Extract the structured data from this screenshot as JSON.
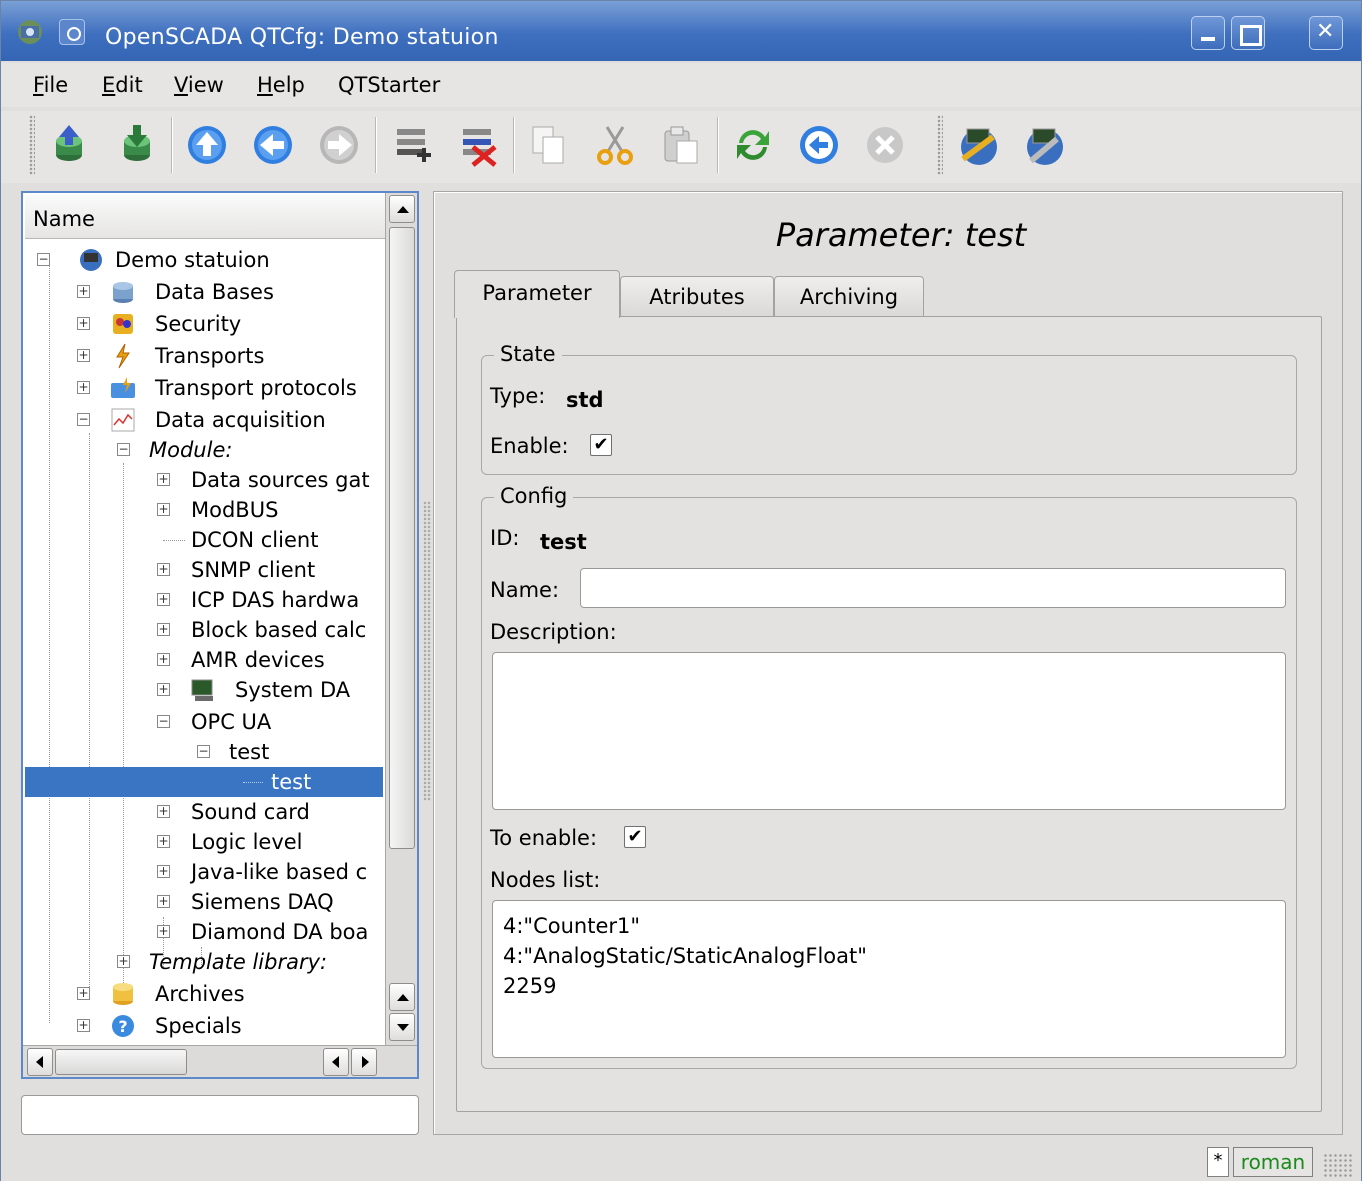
{
  "window": {
    "title": "OpenSCADA QTCfg: Demo statuion"
  },
  "menu": [
    "File",
    "Edit",
    "View",
    "Help",
    "QTStarter"
  ],
  "toolbar": {
    "icons": [
      "load-db-icon",
      "save-db-icon",
      "up-icon",
      "back-icon",
      "forward-icon",
      "add-item-icon",
      "delete-item-icon",
      "copy-icon",
      "cut-icon",
      "paste-icon",
      "refresh-icon",
      "start-icon",
      "stop-icon",
      "remote-station-icon",
      "station-config-icon"
    ]
  },
  "tree": {
    "header": "Name",
    "nodes": [
      {
        "label": "Demo statuion"
      },
      {
        "label": "Data Bases"
      },
      {
        "label": "Security"
      },
      {
        "label": "Transports"
      },
      {
        "label": "Transport protocols"
      },
      {
        "label": "Data acquisition"
      },
      {
        "label": "Module:"
      },
      {
        "label": "Data sources gat"
      },
      {
        "label": "ModBUS"
      },
      {
        "label": "DCON client"
      },
      {
        "label": "SNMP client"
      },
      {
        "label": "ICP DAS hardwa"
      },
      {
        "label": "Block based calc"
      },
      {
        "label": "AMR devices"
      },
      {
        "label": "System DA"
      },
      {
        "label": "OPC UA"
      },
      {
        "label": "test"
      },
      {
        "label": "test"
      },
      {
        "label": "Sound card"
      },
      {
        "label": "Logic level"
      },
      {
        "label": "Java-like based c"
      },
      {
        "label": "Siemens DAQ"
      },
      {
        "label": "Diamond DA boa"
      },
      {
        "label": "Template library:"
      },
      {
        "label": "Archives"
      },
      {
        "label": "Specials"
      }
    ]
  },
  "panel": {
    "title": "Parameter: test",
    "tabs": [
      "Parameter",
      "Atributes",
      "Archiving"
    ],
    "state": {
      "group": "State",
      "type_label": "Type:",
      "type_value": "std",
      "enable_label": "Enable:",
      "enable_checked": true
    },
    "config": {
      "group": "Config",
      "id_label": "ID:",
      "id_value": "test",
      "name_label": "Name:",
      "name_value": "",
      "description_label": "Description:",
      "description_value": "",
      "to_enable_label": "To enable:",
      "to_enable_checked": true,
      "nodes_label": "Nodes list:",
      "nodes_value": "4:\"Counter1\"\n4:\"AnalogStatic/StaticAnalogFloat\"\n2259"
    }
  },
  "status": {
    "modified": "*",
    "user": "roman",
    "user_color": "#1c8a1c"
  },
  "colors": {
    "selection": "#3a75c4",
    "titlebar": "#3f6fbf"
  }
}
